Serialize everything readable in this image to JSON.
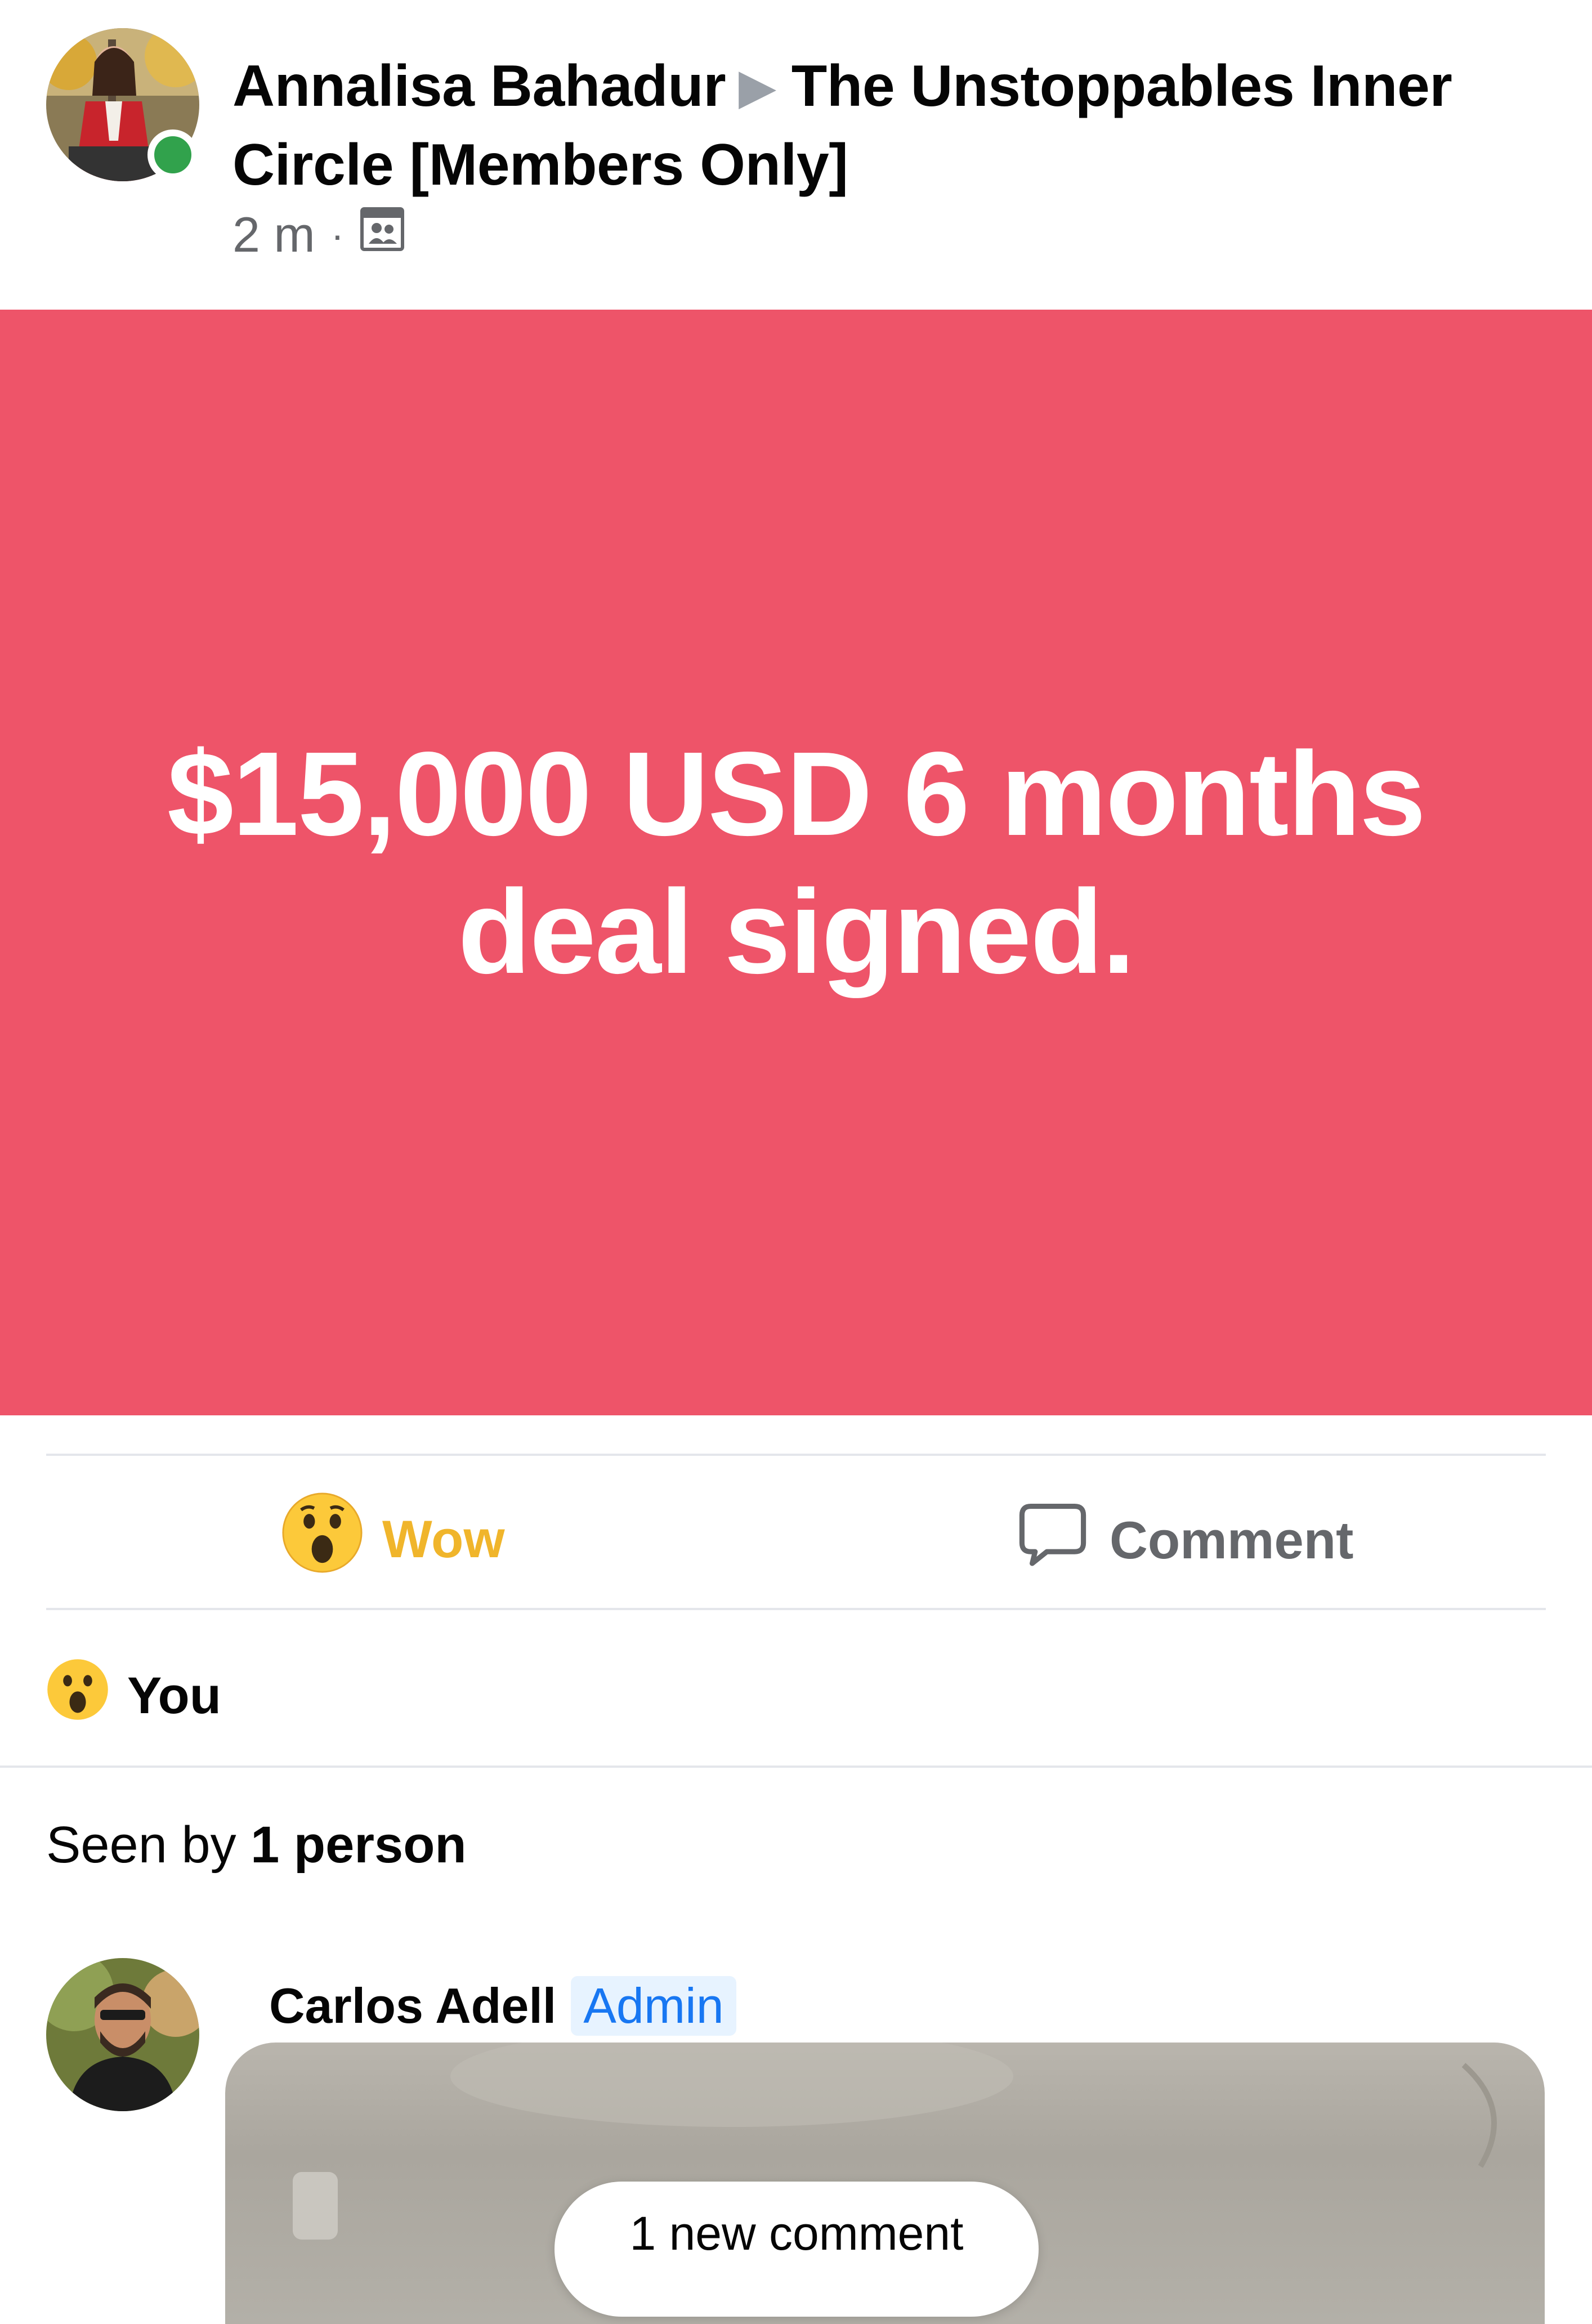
{
  "post": {
    "author": "Annalisa Bahadur",
    "group_line1": "The Unstoppables Inner",
    "group_line2": "Circle [Members Only]",
    "time": "2 m",
    "audience_icon": "group-audience-icon"
  },
  "banner": {
    "line1": "$15,000 USD 6 months",
    "line2": "deal signed.",
    "background_color": "#ee5469"
  },
  "actions": {
    "reaction_label": "Wow",
    "reaction_color": "#f0b52b",
    "comment_label": "Comment"
  },
  "reactions": {
    "reactor": "You"
  },
  "seen": {
    "prefix": "Seen by",
    "count": "1 person"
  },
  "comment": {
    "author": "Carlos Adell",
    "badge": "Admin",
    "new_comment_pill": "1 new comment"
  }
}
